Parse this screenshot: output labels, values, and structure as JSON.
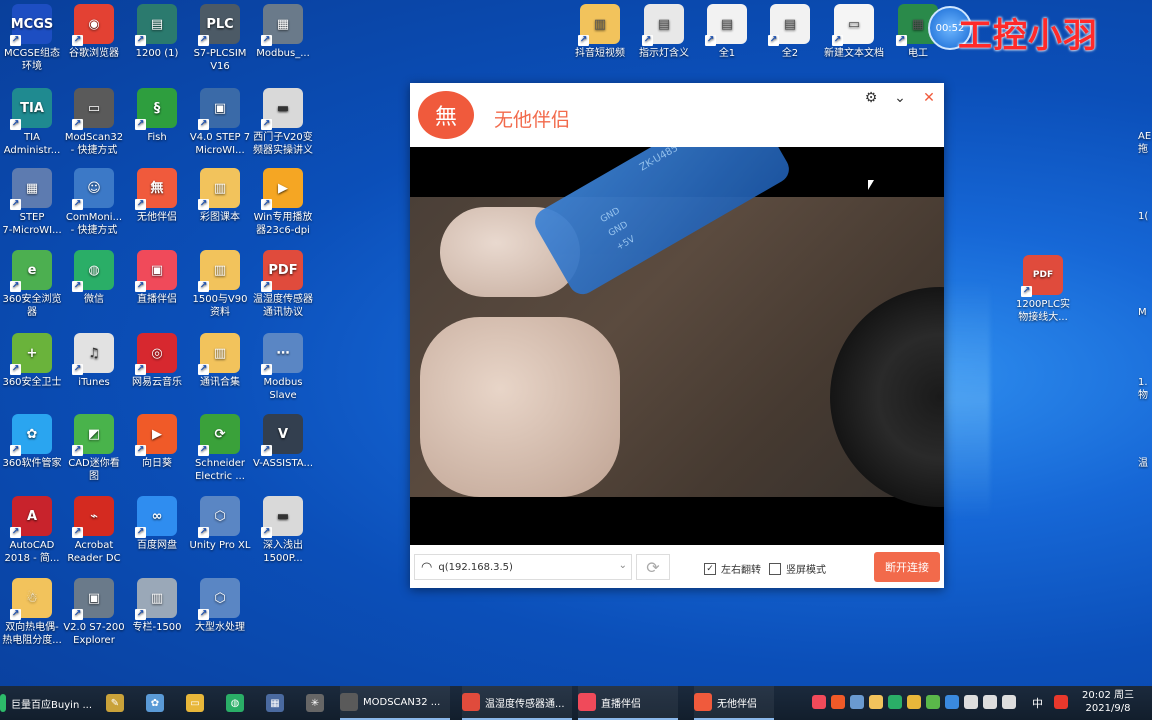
{
  "desktop": {
    "icons": [
      {
        "id": "mcgse",
        "label": "MCGSE组态\n环境",
        "text": "MCGS",
        "color": "#1d4ec2"
      },
      {
        "id": "chrome",
        "label": "谷歌浏览器",
        "text": "◉",
        "color": "#e34133"
      },
      {
        "id": "p1200",
        "label": "1200 (1)",
        "text": "▤",
        "color": "#2b7a6e"
      },
      {
        "id": "plcsim",
        "label": "S7-PLCSIM\nV16",
        "text": "PLC",
        "color": "#4c5a66"
      },
      {
        "id": "modbus",
        "label": "Modbus_...",
        "text": "▦",
        "color": "#6a7a8a"
      },
      {
        "id": "tia",
        "label": "TIA\nAdministr...",
        "text": "TIA",
        "color": "#1f8a90"
      },
      {
        "id": "modscan",
        "label": "ModScan32\n- 快捷方式",
        "text": "▭",
        "color": "#5a5a5a"
      },
      {
        "id": "fish",
        "label": "Fish",
        "text": "§",
        "color": "#2e9e3e"
      },
      {
        "id": "step7v4",
        "label": "V4.0 STEP 7\nMicroWI...",
        "text": "▣",
        "color": "#3a6aa8"
      },
      {
        "id": "v20",
        "label": "西门子V20变\n频器实操讲义",
        "text": "▬",
        "color": "#d9d9d9"
      },
      {
        "id": "step7",
        "label": "STEP\n7-MicroWI...",
        "text": "▦",
        "color": "#5d7bb0"
      },
      {
        "id": "commoni",
        "label": "ComMoni...\n- 快捷方式",
        "text": "☺",
        "color": "#3c79c7"
      },
      {
        "id": "wuta",
        "label": "无他伴侣",
        "text": "無",
        "color": "#f05a3c"
      },
      {
        "id": "caitu",
        "label": "彩图课本",
        "text": "▥",
        "color": "#f2c35c"
      },
      {
        "id": "winplayer",
        "label": "Win专用播放\n器23c6-dpi",
        "text": "▶",
        "color": "#f5a623"
      },
      {
        "id": "s360browser",
        "label": "360安全浏览\n器",
        "text": "e",
        "color": "#4caf50"
      },
      {
        "id": "wechat",
        "label": "微信",
        "text": "◍",
        "color": "#2aae67"
      },
      {
        "id": "zhibo",
        "label": "直播伴侣",
        "text": "▣",
        "color": "#f04a5a"
      },
      {
        "id": "v90",
        "label": "1500与V90\n资料",
        "text": "▥",
        "color": "#f2c35c"
      },
      {
        "id": "tempproto",
        "label": "温湿度传感器\n通讯协议",
        "text": "PDF",
        "color": "#e04b3c"
      },
      {
        "id": "guard360",
        "label": "360安全卫士",
        "text": "+",
        "color": "#6ab33b"
      },
      {
        "id": "itunes",
        "label": "iTunes",
        "text": "♫",
        "color": "#e2e2e2"
      },
      {
        "id": "netease",
        "label": "网易云音乐",
        "text": "◎",
        "color": "#d7282f"
      },
      {
        "id": "tongxun",
        "label": "通讯合集",
        "text": "▥",
        "color": "#f2c35c"
      },
      {
        "id": "modbusslave",
        "label": "Modbus\nSlave",
        "text": "⋯",
        "color": "#5a86c4"
      },
      {
        "id": "soft360",
        "label": "360软件管家",
        "text": "✿",
        "color": "#2aa5f0"
      },
      {
        "id": "cad",
        "label": "CAD迷你看\n图",
        "text": "◩",
        "color": "#49b34b"
      },
      {
        "id": "xiangrikui",
        "label": "向日葵",
        "text": "▶",
        "color": "#f05a28"
      },
      {
        "id": "schneider",
        "label": "Schneider\nElectric ...",
        "text": "⟳",
        "color": "#3aa13a"
      },
      {
        "id": "vassist",
        "label": "V-ASSISTA...",
        "text": "V",
        "color": "#333f4f"
      },
      {
        "id": "autocad",
        "label": "AutoCAD\n2018 - 简...",
        "text": "A",
        "color": "#c8232c"
      },
      {
        "id": "acrobat",
        "label": "Acrobat\nReader DC",
        "text": "⌁",
        "color": "#d42a20"
      },
      {
        "id": "baidu",
        "label": "百度网盘",
        "text": "∞",
        "color": "#2f8df0"
      },
      {
        "id": "unity",
        "label": "Unity Pro XL",
        "text": "⬡",
        "color": "#5a86c4"
      },
      {
        "id": "shenru",
        "label": "深入浅出\n1500P...",
        "text": "▬",
        "color": "#d9d9d9"
      },
      {
        "id": "heater",
        "label": "双向热电偶-\n热电阻分度...",
        "text": "☃",
        "color": "#f2c35c"
      },
      {
        "id": "s7200",
        "label": "V2.0 S7-200\nExplorer",
        "text": "▣",
        "color": "#6a7a8a"
      },
      {
        "id": "zhuanlan",
        "label": "专栏-1500",
        "text": "▥",
        "color": "#9aa8b8"
      },
      {
        "id": "water",
        "label": "大型水处理",
        "text": "⬡",
        "color": "#5a86c4"
      }
    ],
    "top_icons": [
      {
        "id": "douyin",
        "label": "抖音短视频",
        "text": "▥",
        "color": "#f2c35c"
      },
      {
        "id": "zhishideng",
        "label": "指示灯含义",
        "text": "▤",
        "color": "#e8e8e8"
      },
      {
        "id": "quan1",
        "label": "全1",
        "text": "▤",
        "color": "#f2f2f2"
      },
      {
        "id": "quan2",
        "label": "全2",
        "text": "▤",
        "color": "#f2f2f2"
      },
      {
        "id": "newtxt",
        "label": "新建文本文档",
        "text": "▭",
        "color": "#f5f5f5"
      },
      {
        "id": "diangong",
        "label": "电工",
        "text": "▦",
        "color": "#2a8a4a"
      }
    ],
    "right_icon": {
      "id": "pdf1200",
      "label": "1200PLC实\n物接线大...",
      "text": "PDF",
      "color": "#e04b3c"
    },
    "edge_texts": [
      "AE\n拖",
      "1(",
      "M",
      "1.\n物",
      "温"
    ]
  },
  "watermark": "工控小羽",
  "timer": "00:52",
  "app": {
    "title": "无他伴侣",
    "connection": "q(192.168.3.5)",
    "mirror_label": "左右翻转",
    "mirror_checked": "✓",
    "portrait_label": "竖屏模式",
    "disconnect_label": "断开连接",
    "video_texts": {
      "gnd1": "GND",
      "gnd2": "GND",
      "plus5v": "+5V",
      "brand": "ZK-U485"
    }
  },
  "taskbar": {
    "items": [
      {
        "id": "juliang",
        "label": "巨量百应Buyin ...",
        "color": "#2dbb6a"
      },
      {
        "id": "modscan",
        "label": "MODSCAN32 ...",
        "color": "#5a5a5a"
      },
      {
        "id": "wenshidu",
        "label": "温湿度传感器通...",
        "color": "#e04b3c"
      },
      {
        "id": "zhibo",
        "label": "直播伴侣",
        "color": "#f04a5a"
      },
      {
        "id": "wuta",
        "label": "无他伴侣",
        "color": "#f05a3c"
      }
    ],
    "ime": "中",
    "time": "20:02 周三",
    "date": "2021/9/8"
  }
}
